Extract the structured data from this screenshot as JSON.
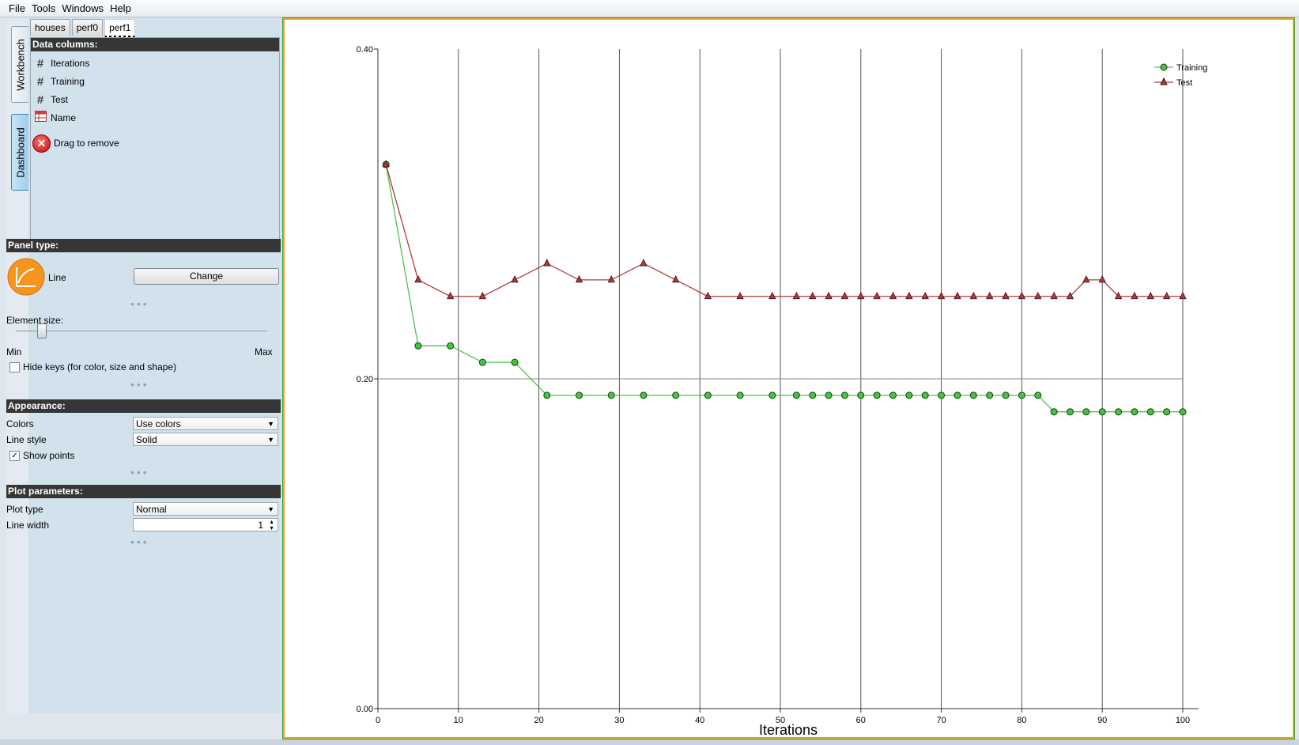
{
  "menu": [
    "File",
    "Tools",
    "Windows",
    "Help"
  ],
  "side_tabs": {
    "workbench": "Workbench",
    "dashboard": "Dashboard"
  },
  "dataset_tabs": [
    "houses",
    "perf0",
    "perf1"
  ],
  "data_columns": {
    "header": "Data columns:",
    "items": [
      {
        "label": "Iterations",
        "icon": "hash-icon"
      },
      {
        "label": "Training",
        "icon": "hash-icon"
      },
      {
        "label": "Test",
        "icon": "hash-icon"
      },
      {
        "label": "Name",
        "icon": "table-icon"
      }
    ],
    "remove_label": "Drag to remove"
  },
  "panel_type": {
    "header": "Panel type:",
    "type_label": "Line",
    "change_button": "Change",
    "element_size_label": "Element size:",
    "slider_min": "Min",
    "slider_max": "Max",
    "slider_value": 0.1,
    "hide_keys_label": "Hide keys (for color, size and shape)",
    "hide_keys_checked": false
  },
  "appearance": {
    "header": "Appearance:",
    "colors_label": "Colors",
    "colors_value": "Use colors",
    "line_style_label": "Line style",
    "line_style_value": "Solid",
    "show_points_label": "Show points",
    "show_points_checked": true
  },
  "plot_parameters": {
    "header": "Plot parameters:",
    "plot_type_label": "Plot type",
    "plot_type_value": "Normal",
    "line_width_label": "Line width",
    "line_width_value": "1"
  },
  "colors": {
    "training": "#3cc93c",
    "training_line": "#4ec24e",
    "test": "#b03a3a",
    "accent": "#f0a030"
  },
  "chart_data": {
    "type": "line",
    "xlabel": "Iterations",
    "ylabel": "",
    "xlim": [
      0,
      100
    ],
    "ylim": [
      0,
      0.4
    ],
    "xticks": [
      "0",
      "10",
      "20",
      "30",
      "40",
      "50",
      "60",
      "70",
      "80",
      "90",
      "100"
    ],
    "yticks": [
      "0.00",
      "0.20",
      "0.40"
    ],
    "grid": "vertical lines at x ticks, horizontal line at 0.20",
    "legend_position": "top-right",
    "x": [
      1,
      5,
      9,
      13,
      17,
      21,
      25,
      29,
      33,
      37,
      41,
      45,
      49,
      52,
      54,
      56,
      58,
      60,
      62,
      64,
      66,
      68,
      70,
      72,
      74,
      76,
      78,
      80,
      82,
      84,
      86,
      88,
      90,
      92,
      94,
      96,
      98,
      100
    ],
    "series": [
      {
        "name": "Training",
        "marker": "circle",
        "values": [
          0.33,
          0.22,
          0.22,
          0.21,
          0.21,
          0.19,
          0.19,
          0.19,
          0.19,
          0.19,
          0.19,
          0.19,
          0.19,
          0.19,
          0.19,
          0.19,
          0.19,
          0.19,
          0.19,
          0.19,
          0.19,
          0.19,
          0.19,
          0.19,
          0.19,
          0.19,
          0.19,
          0.19,
          0.19,
          0.18,
          0.18,
          0.18,
          0.18,
          0.18,
          0.18,
          0.18,
          0.18,
          0.18
        ]
      },
      {
        "name": "Test",
        "marker": "triangle",
        "values": [
          0.33,
          0.26,
          0.25,
          0.25,
          0.26,
          0.27,
          0.26,
          0.26,
          0.27,
          0.26,
          0.25,
          0.25,
          0.25,
          0.25,
          0.25,
          0.25,
          0.25,
          0.25,
          0.25,
          0.25,
          0.25,
          0.25,
          0.25,
          0.25,
          0.25,
          0.25,
          0.25,
          0.25,
          0.25,
          0.25,
          0.25,
          0.26,
          0.26,
          0.25,
          0.25,
          0.25,
          0.25,
          0.25
        ]
      }
    ]
  }
}
